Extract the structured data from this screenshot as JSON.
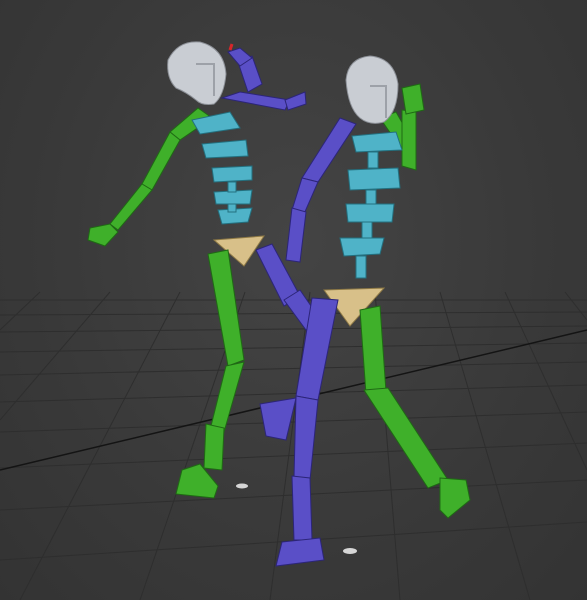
{
  "viewport": {
    "colors": {
      "background": "#3b3b3b",
      "grid": "#2c2c2c",
      "grid_axis": "#141414",
      "head": "#c9cdd3",
      "spine": "#4fb3c8",
      "pelvis": "#d8c089",
      "left_limbs": "#3fb02a",
      "right_limbs": "#5a4fc7",
      "hand_marker": "#d8262a"
    }
  },
  "scene": {
    "figures": [
      {
        "name": "biped-left",
        "parts": [
          "head",
          "spine",
          "pelvis",
          "left-arm",
          "right-arm",
          "left-leg",
          "right-leg"
        ]
      },
      {
        "name": "biped-right",
        "parts": [
          "head",
          "spine",
          "pelvis",
          "left-arm",
          "right-arm",
          "left-leg",
          "right-leg"
        ]
      }
    ]
  }
}
